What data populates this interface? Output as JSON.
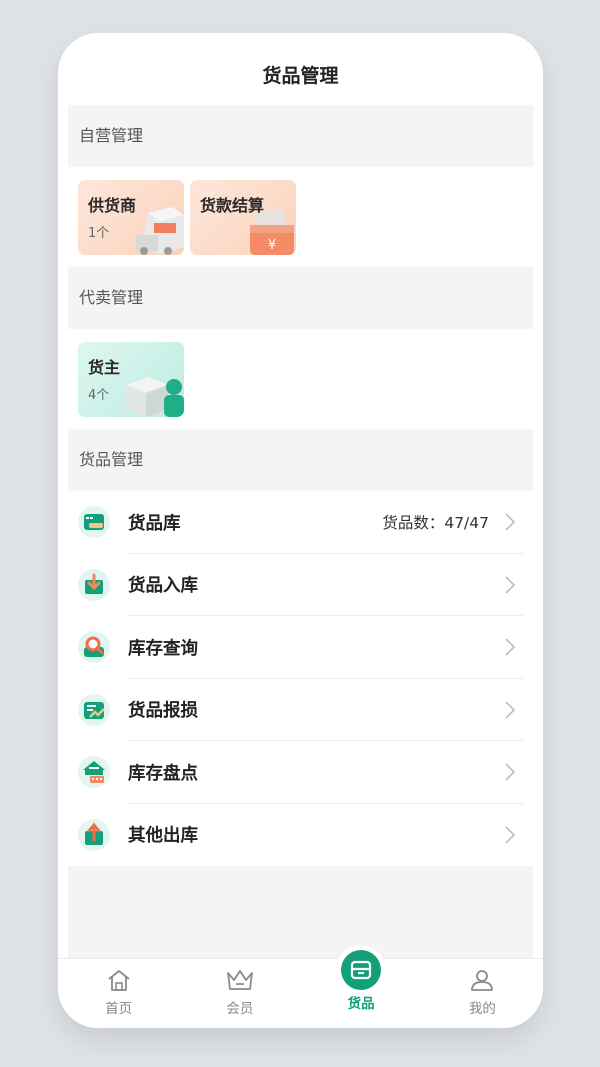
{
  "header": {
    "title": "货品管理"
  },
  "sections": {
    "self_operated": {
      "title": "自营管理",
      "cards": [
        {
          "title": "供货商",
          "subtitle": "1个"
        },
        {
          "title": "货款结算",
          "subtitle": ""
        }
      ],
      "settlement_symbol": "¥"
    },
    "consignment": {
      "title": "代卖管理",
      "cards": [
        {
          "title": "货主",
          "subtitle": "4个"
        }
      ]
    },
    "goods": {
      "title": "货品管理",
      "items": [
        {
          "label": "货品库",
          "extra": "货品数：47/47",
          "icon": "goods-library-icon"
        },
        {
          "label": "货品入库",
          "extra": "",
          "icon": "goods-inbound-icon"
        },
        {
          "label": "库存查询",
          "extra": "",
          "icon": "inventory-query-icon"
        },
        {
          "label": "货品报损",
          "extra": "",
          "icon": "goods-loss-report-icon"
        },
        {
          "label": "库存盘点",
          "extra": "",
          "icon": "stocktaking-icon"
        },
        {
          "label": "其他出库",
          "extra": "",
          "icon": "other-outbound-icon"
        }
      ]
    }
  },
  "tabbar": {
    "items": [
      {
        "label": "首页",
        "icon": "home-icon",
        "active": false
      },
      {
        "label": "会员",
        "icon": "crown-icon",
        "active": false
      },
      {
        "label": "货品",
        "icon": "goods-box-icon",
        "active": true
      },
      {
        "label": "我的",
        "icon": "user-icon",
        "active": false
      }
    ]
  },
  "colors": {
    "accent": "#12a07a",
    "orange_card": "#fbd2bb",
    "teal_card": "#bdece0",
    "page_bg": "#f4f4f4"
  }
}
